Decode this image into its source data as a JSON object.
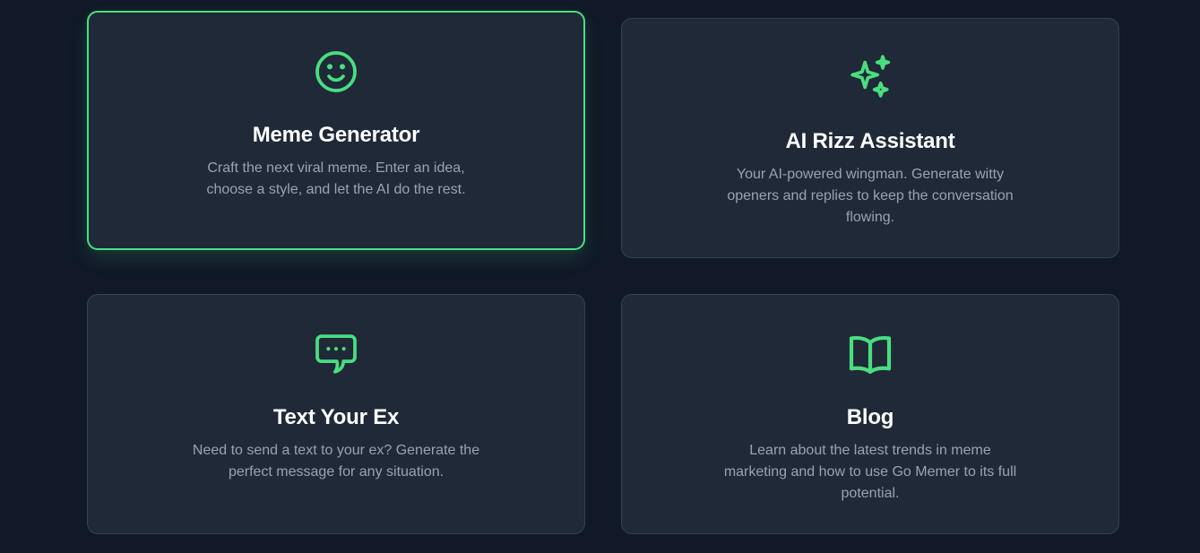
{
  "cards": [
    {
      "icon": "smile-icon",
      "title": "Meme Generator",
      "description": "Craft the next viral meme. Enter an idea, choose a style, and let the AI do the rest.",
      "active": true
    },
    {
      "icon": "sparkles-icon",
      "title": "AI Rizz Assistant",
      "description": "Your AI-powered wingman. Generate witty openers and replies to keep the conversation flowing.",
      "active": false
    },
    {
      "icon": "chat-bubble-icon",
      "title": "Text Your Ex",
      "description": "Need to send a text to your ex? Generate the perfect message for any situation.",
      "active": false
    },
    {
      "icon": "book-open-icon",
      "title": "Blog",
      "description": "Learn about the latest trends in meme marketing and how to use Go Memer to its full potential.",
      "active": false
    }
  ],
  "colors": {
    "background": "#111827",
    "card": "#1f2937",
    "accent": "#4ade80",
    "title": "#ffffff",
    "description": "#9ca3af"
  }
}
